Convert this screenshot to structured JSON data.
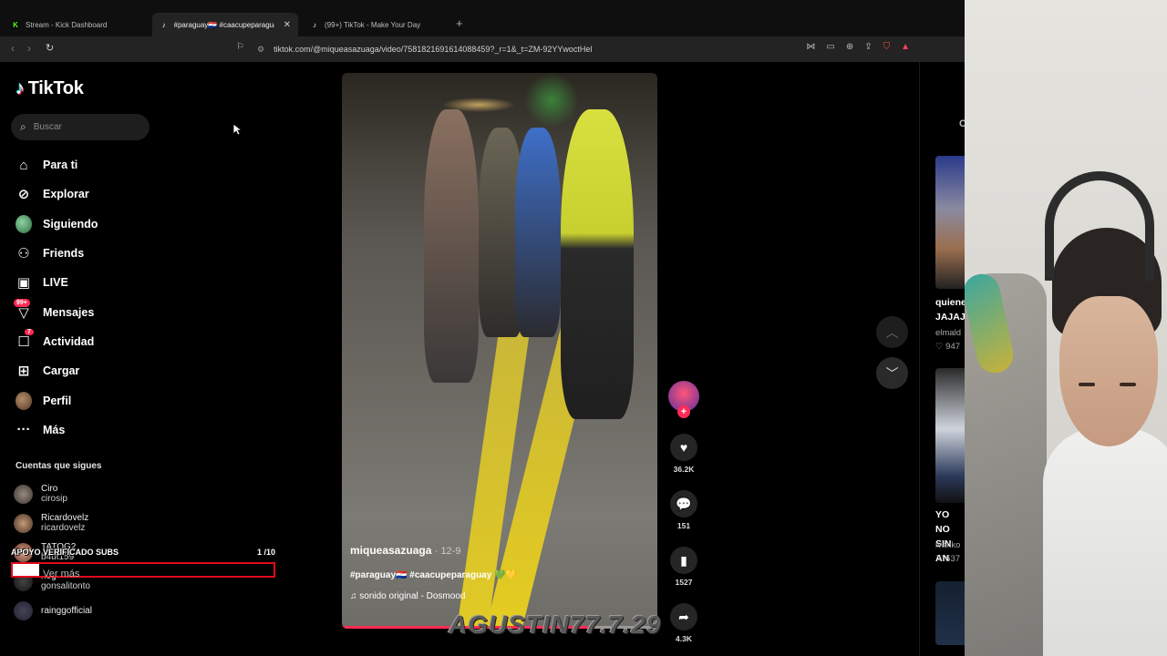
{
  "browser": {
    "tabs": [
      {
        "label": "Stream - Kick Dashboard",
        "icon": "kick-icon"
      },
      {
        "label": "#paraguay🇵🇾 #caacupeparaguay 💚",
        "icon": "tiktok-icon",
        "active": true
      },
      {
        "label": "(99+) TikTok - Make Your Day",
        "icon": "tiktok-icon"
      }
    ],
    "url": "tiktok.com/@miqueasazuaga/video/7581821691614088459?_r=1&_t=ZM-92YYwoctHel"
  },
  "sidebar": {
    "logo": "TikTok",
    "search_placeholder": "Buscar",
    "nav": [
      {
        "label": "Para ti",
        "icon": "home-icon"
      },
      {
        "label": "Explorar",
        "icon": "compass-icon"
      },
      {
        "label": "Siguiendo",
        "icon": "following-avatar"
      },
      {
        "label": "Friends",
        "icon": "friends-icon"
      },
      {
        "label": "LIVE",
        "icon": "live-icon"
      },
      {
        "label": "Mensajes",
        "icon": "messages-icon",
        "badge": "99+"
      },
      {
        "label": "Actividad",
        "icon": "activity-icon",
        "badge": "7"
      },
      {
        "label": "Cargar",
        "icon": "upload-icon"
      },
      {
        "label": "Perfil",
        "icon": "profile-avatar"
      },
      {
        "label": "Más",
        "icon": "more-icon"
      }
    ],
    "following_title": "Cuentas que sigues",
    "accounts": [
      {
        "name": "Ciro",
        "user": "cirosip"
      },
      {
        "name": "Ricardovelz",
        "user": "ricardovelz"
      },
      {
        "name": "TATOG2",
        "user": "b4ut159"
      },
      {
        "name": "nog",
        "user": "gonsalitonto"
      },
      {
        "name": "rainggofficial",
        "user": ""
      }
    ],
    "see_more": "Ver más"
  },
  "overlay": {
    "subs_label": "APOYO VERIFICADO SUBS",
    "subs_count": "1 /10",
    "subs_progress": 0.1,
    "watermark": "AGUSTIN77.7.29"
  },
  "video": {
    "author": "miqueasazuaga",
    "date": "· 12-9",
    "tags": "#paraguay🇵🇾 #caacupeparaguay 💚💛",
    "sound": "♫  sonido original - Dosmood",
    "likes": "36.2K",
    "comments": "151",
    "saves": "1527",
    "shares": "4.3K"
  },
  "right_panel": {
    "header": "C",
    "items": [
      {
        "line1": "quiene",
        "line2": "JAJAJ",
        "user": "elmald",
        "likes": "947"
      },
      {
        "line1": "YO NO",
        "line2": "SIN AN",
        "user": "ivanko",
        "likes": "537"
      }
    ]
  }
}
